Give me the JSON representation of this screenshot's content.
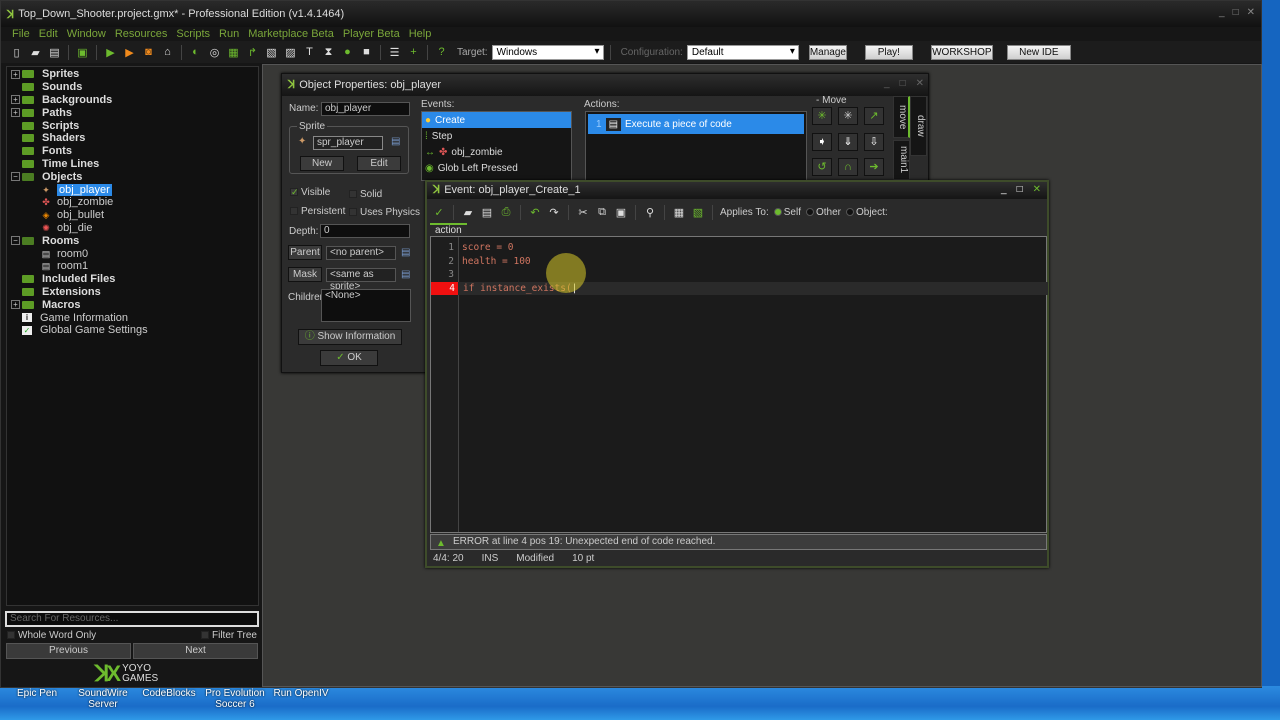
{
  "window": {
    "title": "Top_Down_Shooter.project.gmx* - Professional Edition (v1.4.1464)",
    "controls": {
      "minimize": "_",
      "maximize": "□",
      "close": "✕"
    }
  },
  "menu": [
    "File",
    "Edit",
    "Window",
    "Resources",
    "Scripts",
    "Run",
    "Marketplace Beta",
    "Player Beta",
    "Help"
  ],
  "toolbar": {
    "icons": [
      "new-file-icon",
      "open-icon",
      "save-icon",
      "export-icon",
      "run-icon",
      "debug-icon",
      "stop-icon",
      "clean-icon",
      "create-sprite-icon",
      "create-sound-icon",
      "create-background-icon",
      "create-path-icon",
      "create-script-icon",
      "create-shader-icon",
      "create-font-icon",
      "create-timeline-icon",
      "create-object-icon",
      "create-room-icon",
      "list-icon",
      "add-icon",
      "help-icon"
    ],
    "target_label": "Target:",
    "target_value": "Windows",
    "config_label": "Configuration:",
    "config_value": "Default",
    "manage": "Manage",
    "play": "Play!",
    "workshop": "WORKSHOP",
    "new_ide": "New IDE"
  },
  "tree": {
    "folders": [
      {
        "label": "Sprites",
        "expandable": true
      },
      {
        "label": "Sounds",
        "expandable": false
      },
      {
        "label": "Backgrounds",
        "expandable": true
      },
      {
        "label": "Paths",
        "expandable": true
      },
      {
        "label": "Scripts",
        "expandable": false
      },
      {
        "label": "Shaders",
        "expandable": false
      },
      {
        "label": "Fonts",
        "expandable": false
      },
      {
        "label": "Time Lines",
        "expandable": false
      }
    ],
    "objects_label": "Objects",
    "objects": [
      "obj_player",
      "obj_zombie",
      "obj_bullet",
      "obj_die"
    ],
    "selected_object": "obj_player",
    "rooms_label": "Rooms",
    "rooms": [
      "room0",
      "room1"
    ],
    "folders2": [
      {
        "label": "Included Files",
        "expandable": false
      },
      {
        "label": "Extensions",
        "expandable": false
      },
      {
        "label": "Macros",
        "expandable": true
      }
    ],
    "game_information": "Game Information",
    "global_settings": "Global Game Settings"
  },
  "search": {
    "placeholder": "Search For Resources...",
    "whole_word": "Whole Word Only",
    "filter_tree": "Filter Tree",
    "previous": "Previous",
    "next": "Next"
  },
  "logo": {
    "line1": "YOYO",
    "line2": "GAMES"
  },
  "desktop_icons": [
    "Epic Pen",
    "SoundWire Server",
    "CodeBlocks",
    "Pro Evolution Soccer 6",
    "Run OpenIV"
  ],
  "object_properties": {
    "title": "Object Properties: obj_player",
    "name_label": "Name:",
    "name_value": "obj_player",
    "sprite_label": "Sprite",
    "sprite_value": "spr_player",
    "new": "New",
    "edit": "Edit",
    "visible": "Visible",
    "visible_checked": true,
    "solid": "Solid",
    "solid_checked": false,
    "persistent": "Persistent",
    "persistent_checked": false,
    "uses_physics": "Uses Physics",
    "uses_physics_checked": false,
    "depth_label": "Depth:",
    "depth_value": "0",
    "parent": "Parent",
    "parent_value": "<no parent>",
    "mask": "Mask",
    "mask_value": "<same as sprite>",
    "children_label": "Children:",
    "children_value": "<None>",
    "show_information": "Show Information",
    "ok": "OK",
    "events_label": "Events:",
    "events": [
      "Create",
      "Step",
      "obj_zombie",
      "Glob Left Pressed"
    ],
    "selected_event": "Create",
    "actions_label": "Actions:",
    "actions": [
      {
        "index": "1",
        "label": "Execute a piece of code"
      }
    ],
    "palette_group": "Move",
    "palette_tabs": [
      "move",
      "main1",
      "draw"
    ]
  },
  "code_editor": {
    "title": "Event: obj_player_Create_1",
    "applies_to": "Applies To:",
    "self": "Self",
    "other": "Other",
    "object": "Object:",
    "applies_selected": "Self",
    "tab": "action",
    "lines": [
      {
        "n": "1",
        "code": "score = 0"
      },
      {
        "n": "2",
        "code": "health = 100"
      },
      {
        "n": "3",
        "code": ""
      },
      {
        "n": "4",
        "code": "if instance_exists("
      }
    ],
    "error_line": 4,
    "error": "ERROR at line 4 pos 19: Unexpected end of code reached.",
    "status": {
      "pos": "4/4: 20",
      "mode": "INS",
      "modified": "Modified",
      "size": "10 pt"
    }
  }
}
